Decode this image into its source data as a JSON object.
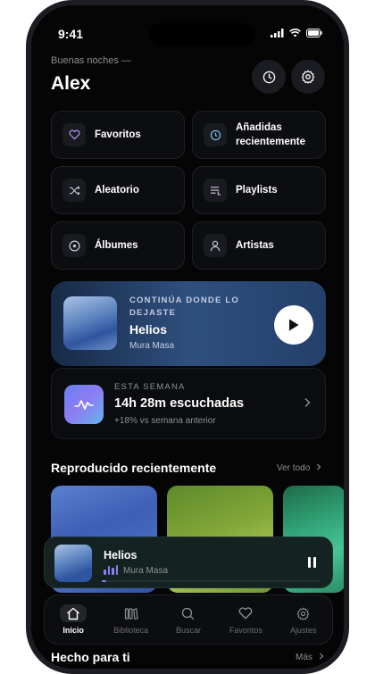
{
  "status": {
    "time": "9:41"
  },
  "header": {
    "greeting": "Buenas noches —",
    "name": "Alex"
  },
  "icons": {
    "history": "clock-icon",
    "settings": "gear-icon"
  },
  "quick": [
    {
      "label": "Favoritos",
      "icon": "heart-icon"
    },
    {
      "label": "Añadidas recientemente",
      "icon": "clock-icon"
    },
    {
      "label": "Aleatorio",
      "icon": "shuffle-icon"
    },
    {
      "label": "Playlists",
      "icon": "playlist-icon"
    },
    {
      "label": "Álbumes",
      "icon": "disc-icon"
    },
    {
      "label": "Artistas",
      "icon": "user-icon"
    }
  ],
  "continue": {
    "kicker": "CONTINÚA DONDE LO DEJASTE",
    "title": "Helios",
    "artist": "Mura Masa"
  },
  "week": {
    "kicker": "ESTA SEMANA",
    "total": "14h 28m escuchadas",
    "delta": "+18% vs semana anterior"
  },
  "recent": {
    "title": "Reproducido recientemente",
    "link": "Ver todo"
  },
  "madeforyou": {
    "title": "Hecho para ti",
    "link": "Más"
  },
  "player": {
    "title": "Helios",
    "artist": "Mura Masa",
    "progress": 0.01,
    "accent": "#8b7df1"
  },
  "tabs": [
    {
      "label": "Inicio",
      "icon": "home-icon",
      "active": true
    },
    {
      "label": "Biblioteca",
      "icon": "library-icon",
      "active": false
    },
    {
      "label": "Buscar",
      "icon": "search-icon",
      "active": false
    },
    {
      "label": "Favoritos",
      "icon": "heart-icon",
      "active": false
    },
    {
      "label": "Ajustes",
      "icon": "gear-icon",
      "active": false
    }
  ]
}
